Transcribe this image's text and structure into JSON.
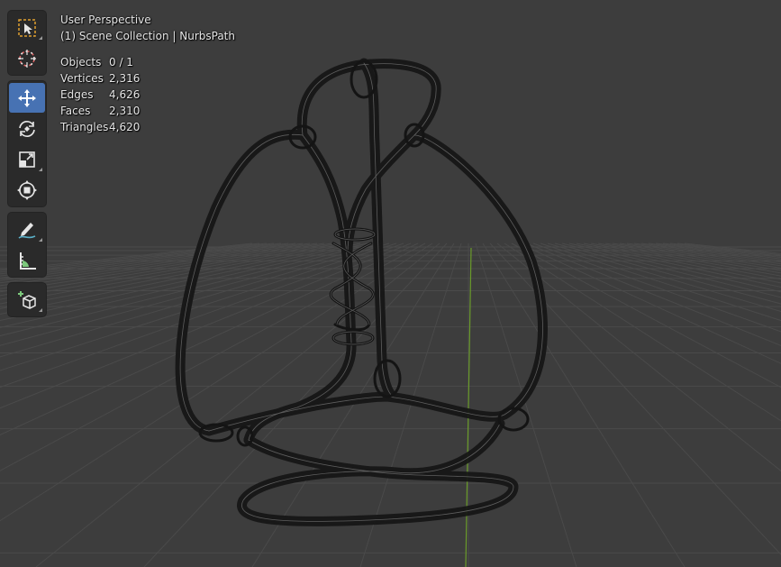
{
  "viewport": {
    "perspective": "User Perspective",
    "collection": "(1) Scene Collection | NurbsPath"
  },
  "stats": [
    {
      "label": "Objects",
      "value": "0 / 1"
    },
    {
      "label": "Vertices",
      "value": "2,316"
    },
    {
      "label": "Edges",
      "value": "4,626"
    },
    {
      "label": "Faces",
      "value": "2,310"
    },
    {
      "label": "Triangles",
      "value": "4,620"
    }
  ],
  "toolbar": {
    "active_tool": "move",
    "groups": [
      [
        "select-box-icon",
        "cursor-icon"
      ],
      [
        "move-icon",
        "rotate-icon",
        "scale-icon",
        "transform-icon"
      ],
      [
        "annotate-icon",
        "measure-icon"
      ],
      [
        "add-cube-icon"
      ]
    ]
  },
  "colors": {
    "background": "#3d3d3d",
    "grid": "#4a4a4a",
    "y_axis": "#6a9b2a",
    "active_tool": "#4772b3",
    "wire": "#141414"
  }
}
